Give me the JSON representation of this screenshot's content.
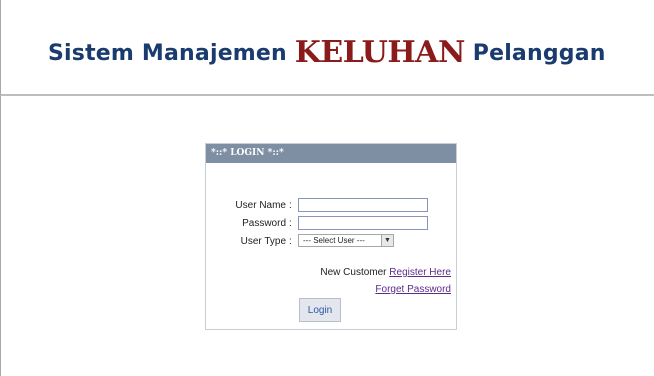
{
  "banner": {
    "part1": "Sistem Manajemen ",
    "highlight": "KELUHAN",
    "part2": " Pelanggan"
  },
  "login_box": {
    "title": "*::* LOGIN *::*",
    "username_label": "User Name",
    "password_label": "Password",
    "usertype_label": "User Type",
    "colon": ":",
    "username_value": "",
    "password_value": "",
    "usertype_selected": "--- Select User ---",
    "new_customer_text": "New Customer",
    "register_link": "Register Here",
    "forget_link": "Forget Password",
    "login_button": "Login"
  },
  "colors": {
    "banner_blue": "#1a3b6e",
    "banner_red": "#8b1a1a",
    "box_header": "#7e8fa4",
    "link": "#5b2c8c"
  }
}
